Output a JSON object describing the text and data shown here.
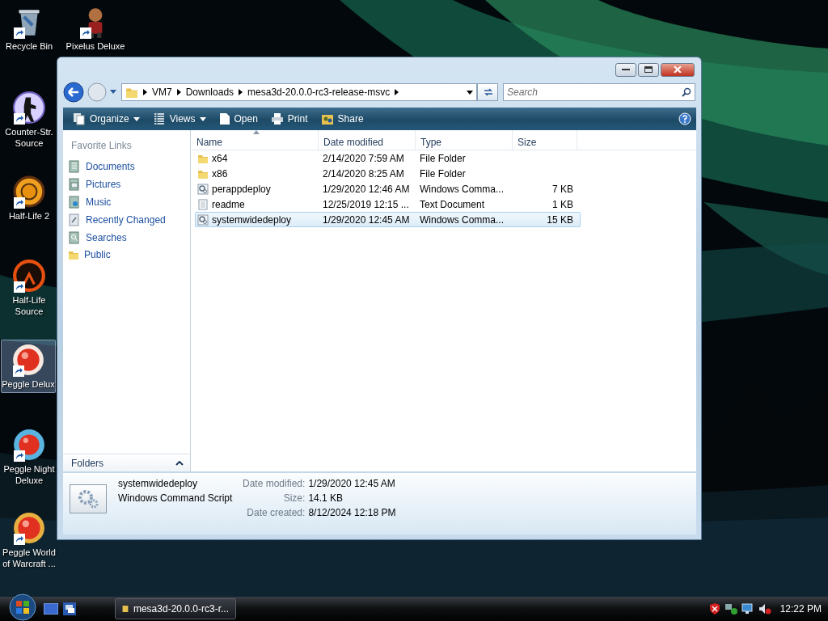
{
  "desktop": {
    "icons": [
      {
        "label": "Recycle Bin",
        "kind": "bin",
        "selected": false
      },
      {
        "label": "Pixelus Deluxe",
        "kind": "figure",
        "selected": false
      },
      {
        "label": "Counter-Str. Source",
        "kind": "soldier",
        "selected": false
      },
      {
        "label": "Half-Life 2",
        "kind": "orange-ring",
        "selected": false
      },
      {
        "label": "Half-Life Source",
        "kind": "dark-ring",
        "selected": false
      },
      {
        "label": "Peggle Delux",
        "kind": "red-ball",
        "selected": true
      },
      {
        "label": "Peggle Night Deluxe",
        "kind": "blue-ball",
        "selected": false
      },
      {
        "label": "Peggle World of Warcraft ...",
        "kind": "gold-ball",
        "selected": false
      }
    ]
  },
  "window": {
    "breadcrumb": [
      "VM7",
      "Downloads",
      "mesa3d-20.0.0-rc3-release-msvc"
    ],
    "search": {
      "placeholder": "Search"
    },
    "toolbar": [
      {
        "label": "Organize",
        "kind": "organize",
        "dropdown": true
      },
      {
        "label": "Views",
        "kind": "views",
        "dropdown": true
      },
      {
        "label": "Open",
        "kind": "open",
        "dropdown": false
      },
      {
        "label": "Print",
        "kind": "print",
        "dropdown": false
      },
      {
        "label": "Share",
        "kind": "share",
        "dropdown": false
      }
    ],
    "favorite_links": {
      "title": "Favorite Links",
      "items": [
        {
          "label": "Documents",
          "kind": "documents"
        },
        {
          "label": "Pictures",
          "kind": "pictures"
        },
        {
          "label": "Music",
          "kind": "music"
        },
        {
          "label": "Recently Changed",
          "kind": "recent"
        },
        {
          "label": "Searches",
          "kind": "searches"
        },
        {
          "label": "Public",
          "kind": "folder"
        }
      ]
    },
    "folders": {
      "label": "Folders"
    },
    "table": {
      "columns": [
        "Name",
        "Date modified",
        "Type",
        "Size"
      ],
      "rows": [
        {
          "name": "x64",
          "date": "2/14/2020 7:59 AM",
          "type": "File Folder",
          "kind": "folder",
          "selected": false
        },
        {
          "name": "x86",
          "date": "2/14/2020 8:25 AM",
          "type": "File Folder",
          "kind": "folder",
          "selected": false
        },
        {
          "name": "perappdeploy",
          "date": "1/29/2020 12:46 AM",
          "type": "Windows Comma...",
          "size": "7 KB",
          "kind": "script",
          "selected": false
        },
        {
          "name": "readme",
          "date": "12/25/2019 12:15 ...",
          "type": "Text Document",
          "size": "1 KB",
          "kind": "text",
          "selected": false
        },
        {
          "name": "systemwidedeploy",
          "date": "1/29/2020 12:45 AM",
          "type": "Windows Comma...",
          "size": "15 KB",
          "kind": "script",
          "selected": true
        }
      ]
    },
    "details": {
      "name": "systemwidedeploy",
      "type": "Windows Command Script",
      "properties": [
        {
          "label": "Date modified:",
          "value": "1/29/2020 12:45 AM"
        },
        {
          "label": "Size:",
          "value": "14.1 KB"
        },
        {
          "label": "Date created:",
          "value": "8/12/2024 12:18 PM"
        }
      ]
    }
  },
  "taskbar": {
    "tasks": [
      {
        "label": "mesa3d-20.0.0-rc3-r..."
      }
    ],
    "clock": "12:22 PM"
  }
}
